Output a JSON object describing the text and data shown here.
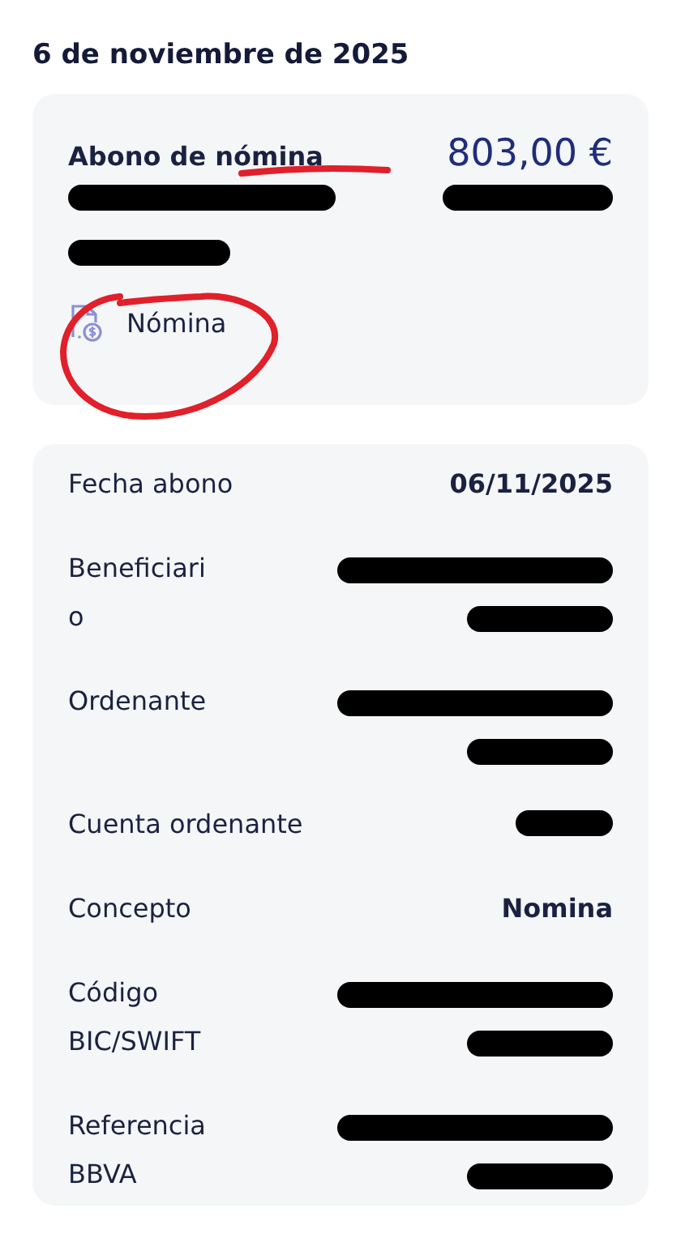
{
  "date_heading": "6 de noviembre de 2025",
  "summary": {
    "title": "Abono de nómina",
    "title_underlined": true,
    "amount": "803,00 €",
    "redacted": true,
    "tag": "Nómina",
    "tag_circled": true
  },
  "details": [
    {
      "label": "Fecha abono",
      "kind": "text",
      "value": "06/11/2025"
    },
    {
      "label": "Beneficiario",
      "kind": "redacted-two"
    },
    {
      "label": "Ordenante",
      "kind": "redacted-two"
    },
    {
      "label": "Cuenta ordenante",
      "kind": "redacted-one"
    },
    {
      "label": "Concepto",
      "kind": "text",
      "value": "Nomina"
    },
    {
      "label": "Código BIC/SWIFT",
      "kind": "redacted-two"
    },
    {
      "label": "Referencia BBVA",
      "kind": "redacted-two"
    }
  ]
}
